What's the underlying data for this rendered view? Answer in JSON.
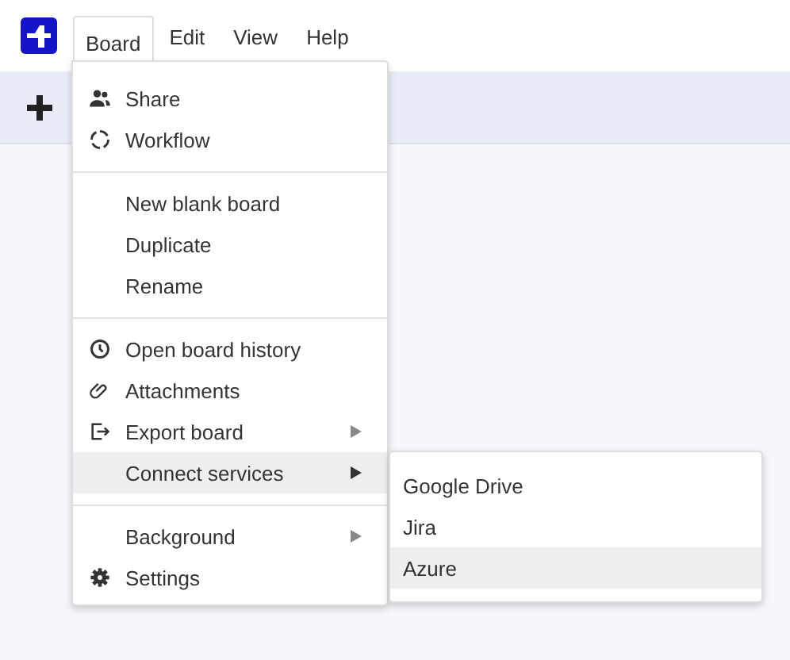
{
  "menubar": [
    {
      "label": "Board",
      "selected": true
    },
    {
      "label": "Edit",
      "selected": false
    },
    {
      "label": "View",
      "selected": false
    },
    {
      "label": "Help",
      "selected": false
    }
  ],
  "board_menu": {
    "groups": [
      [
        {
          "label": "Share",
          "selected": false,
          "has_submenu": false
        },
        {
          "label": "Workflow",
          "selected": false,
          "has_submenu": false
        }
      ],
      [
        {
          "label": "New blank board",
          "selected": false,
          "has_submenu": false
        },
        {
          "label": "Duplicate",
          "selected": false,
          "has_submenu": false
        },
        {
          "label": "Rename",
          "selected": false,
          "has_submenu": false
        }
      ],
      [
        {
          "label": "Open board history",
          "selected": false,
          "has_submenu": false
        },
        {
          "label": "Attachments",
          "selected": false,
          "has_submenu": false
        },
        {
          "label": "Export board",
          "selected": false,
          "has_submenu": true
        },
        {
          "label": "Connect services",
          "selected": true,
          "has_submenu": true
        }
      ],
      [
        {
          "label": "Background",
          "selected": false,
          "has_submenu": true
        },
        {
          "label": "Settings",
          "selected": false,
          "has_submenu": false
        }
      ]
    ]
  },
  "services_menu": {
    "items": [
      {
        "label": "Google Drive",
        "selected": false
      },
      {
        "label": "Jira",
        "selected": false
      },
      {
        "label": "Azure",
        "selected": true
      }
    ]
  }
}
